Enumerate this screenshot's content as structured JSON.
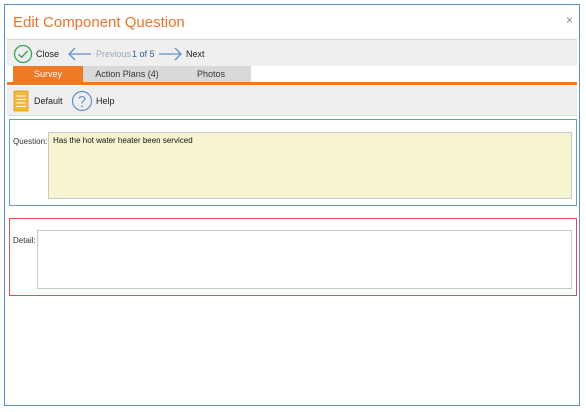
{
  "dialog": {
    "title": "Edit Component Question",
    "close_glyph": "×"
  },
  "toolbar": {
    "close_label": "Close",
    "previous_label": "Previous",
    "page_indicator": "1 of 5",
    "next_label": "Next",
    "icons": {
      "close": "check-circle-icon",
      "previous": "arrow-left-icon",
      "next": "arrow-right-icon"
    }
  },
  "tabs": [
    {
      "label": "Survey",
      "active": true
    },
    {
      "label": "Action Plans (4)",
      "active": false
    },
    {
      "label": "Photos",
      "active": false
    }
  ],
  "toolbar2": {
    "default_label": "Default",
    "help_label": "Help",
    "icons": {
      "default": "document-icon",
      "help": "question-circle-icon"
    }
  },
  "question": {
    "label": "Question:",
    "value": "Has the hot water heater been serviced"
  },
  "detail": {
    "label": "Detail:",
    "value": ""
  },
  "colors": {
    "accent": "#ef7a26",
    "title": "#e8742b",
    "frame": "#5b8fc9",
    "question_border": "#6e9ad4",
    "detail_border": "#dc4a60",
    "question_bg": "#f7f5d0"
  }
}
